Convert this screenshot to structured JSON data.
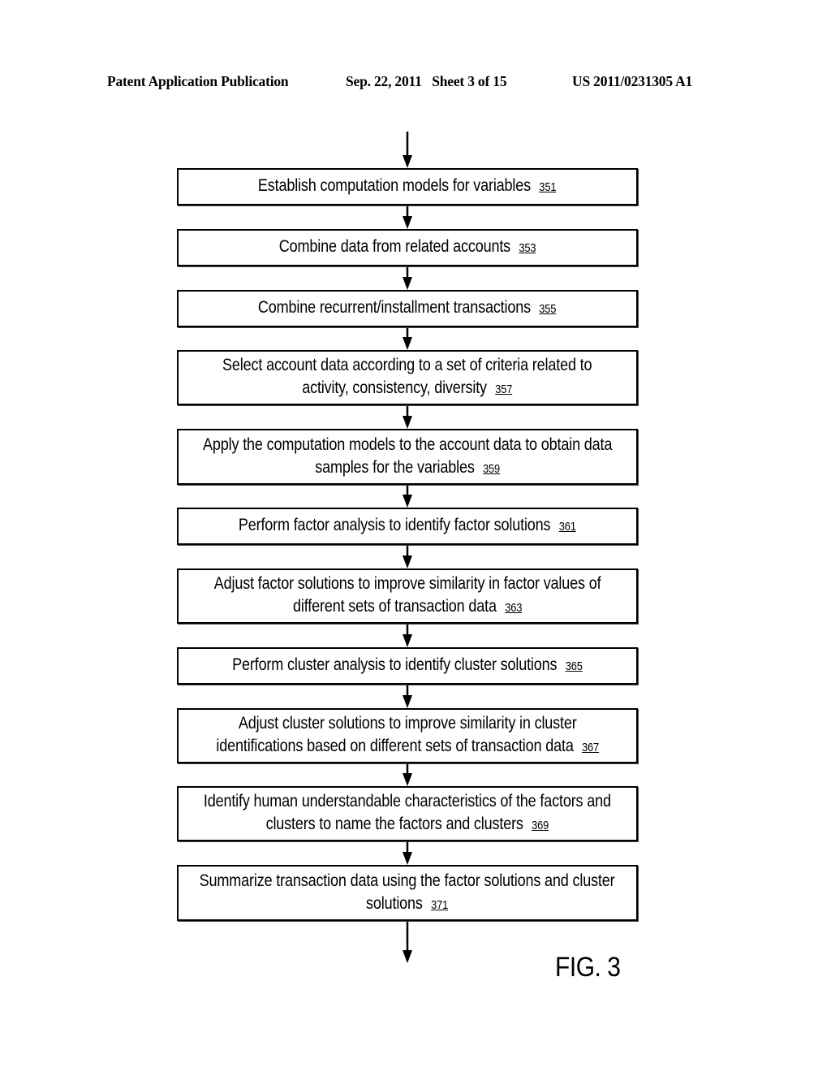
{
  "header": {
    "publication": "Patent Application Publication",
    "date_sheet": "Sep. 22, 2011   Sheet 3 of 15",
    "number": "US 2011/0231305 A1"
  },
  "figure_label": "FIG. 3",
  "steps": [
    {
      "lines": [
        "Establish computation models for variables"
      ],
      "ref": "351"
    },
    {
      "lines": [
        "Combine data from related accounts"
      ],
      "ref": "353"
    },
    {
      "lines": [
        "Combine recurrent/installment transactions"
      ],
      "ref": "355"
    },
    {
      "lines": [
        "Select account data according to a set of criteria related to",
        "activity, consistency, diversity"
      ],
      "ref": "357"
    },
    {
      "lines": [
        "Apply the computation models to the account data to obtain data",
        "samples for the variables"
      ],
      "ref": "359"
    },
    {
      "lines": [
        "Perform factor analysis to identify factor solutions"
      ],
      "ref": "361"
    },
    {
      "lines": [
        "Adjust factor solutions to improve similarity in factor values of",
        "different sets of transaction data"
      ],
      "ref": "363"
    },
    {
      "lines": [
        "Perform cluster analysis to identify cluster solutions"
      ],
      "ref": "365"
    },
    {
      "lines": [
        "Adjust cluster solutions to improve similarity in cluster",
        "identifications based on different sets of transaction data"
      ],
      "ref": "367"
    },
    {
      "lines": [
        "Identify human understandable characteristics of the factors and",
        "clusters to name the factors and clusters"
      ],
      "ref": "369"
    },
    {
      "lines": [
        "Summarize transaction data using the factor solutions and cluster",
        "solutions"
      ],
      "ref": "371"
    }
  ],
  "flow": {
    "entry_arrow": true,
    "exit_arrow": true,
    "connectors": "sequential"
  }
}
